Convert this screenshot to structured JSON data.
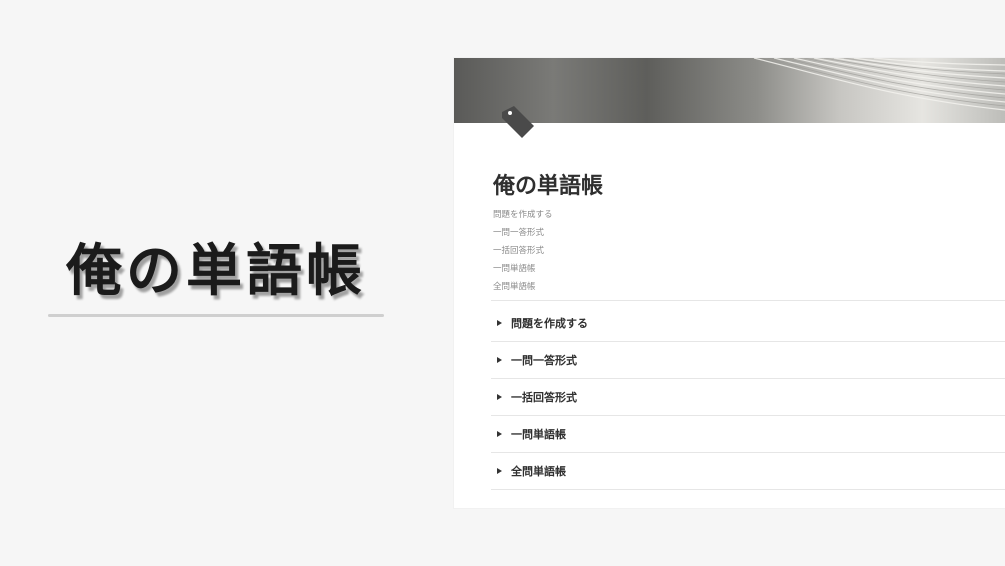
{
  "hero": {
    "title": "俺の単語帳"
  },
  "page": {
    "title": "俺の単語帳",
    "icon": "tag-icon",
    "toc": [
      "問題を作成する",
      "一問一答形式",
      "一括回答形式",
      "一問単語帳",
      "全問単語帳"
    ],
    "toggles": [
      "問題を作成する",
      "一問一答形式",
      "一括回答形式",
      "一問単語帳",
      "全問単語帳"
    ]
  },
  "colors": {
    "background": "#f6f6f6",
    "page": "#ffffff",
    "title_text": "#2f2f2f",
    "toc_text": "#8a8a8a",
    "icon": "#4a4a4a"
  }
}
